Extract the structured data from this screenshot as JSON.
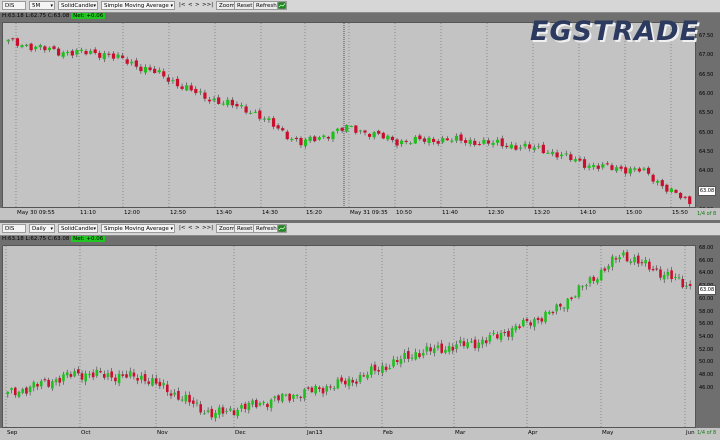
{
  "top": {
    "symbol": "DIS",
    "interval": "5M",
    "chart_style": "SolidCandle",
    "indicator": "Simple Moving Average",
    "nav": [
      "|<",
      "<",
      ">",
      ">>|"
    ],
    "zoom": "Zoom",
    "reset": "Reset",
    "refresh": "Refresh",
    "ohlc": "H:63.18  L:62.75  C:63.08",
    "net": "Net: +0.06",
    "price_tag": "63.08",
    "corner": "1/4 of 8",
    "logo": "EGSTRADE",
    "x_labels": [
      "May 30 09:55",
      "11:10",
      "12:00",
      "12:50",
      "13:40",
      "14:30",
      "15:20",
      "May 31 09:35",
      "10:50",
      "11:40",
      "12:30",
      "13:20",
      "14:10",
      "15:00",
      "15:50"
    ],
    "y_labels": [
      "67.50",
      "67.00",
      "66.50",
      "66.00",
      "65.50",
      "65.00",
      "64.50",
      "64.00",
      "63.50",
      "63.00"
    ]
  },
  "bottom": {
    "symbol": "DIS",
    "interval": "Daily",
    "chart_style": "SolidCandle",
    "indicator": "Simple Moving Average",
    "nav": [
      "|<",
      "<",
      ">",
      ">>|"
    ],
    "zoom": "Zoom",
    "reset": "Reset",
    "refresh": "Refresh",
    "ohlc": "H:63.18  L:62.75  C:63.08",
    "net": "Net: +0.06",
    "price_tag": "63.08",
    "corner": "1/4 of 8",
    "x_labels": [
      "Sep",
      "Oct",
      "Nov",
      "Dec",
      "Jan13",
      "Feb",
      "Mar",
      "Apr",
      "May",
      "Jun"
    ],
    "y_labels": [
      "68.00",
      "66.00",
      "64.00",
      "62.00",
      "60.00",
      "58.00",
      "56.00",
      "54.00",
      "52.00",
      "50.00",
      "48.00",
      "46.00"
    ]
  },
  "colors": {
    "up": "#1fbf1f",
    "down": "#c8102e",
    "plot_bg": "#c3c3c3",
    "net_bg": "#22c622"
  },
  "chart_data": [
    {
      "type": "candlestick",
      "ylim": [
        63.0,
        67.5
      ],
      "x": [
        "May 30 09:55",
        "11:10",
        "12:00",
        "12:50",
        "13:40",
        "14:30",
        "15:20",
        "May 31 09:35",
        "10:50",
        "11:40",
        "12:30",
        "13:20",
        "14:10",
        "15:00",
        "15:50"
      ],
      "close": [
        67.05,
        66.8,
        66.75,
        66.3,
        65.7,
        65.35,
        64.55,
        64.95,
        64.6,
        64.65,
        64.55,
        64.4,
        64.0,
        63.9,
        63.08
      ]
    },
    {
      "type": "candlestick",
      "ylim": [
        46.0,
        68.0
      ],
      "x": [
        "Sep",
        "Oct",
        "Nov",
        "Dec",
        "Jan13",
        "Feb",
        "Mar",
        "Apr",
        "May",
        "Jun"
      ],
      "close": [
        50.0,
        52.5,
        52.0,
        47.5,
        49.5,
        51.5,
        55.0,
        56.5,
        60.0,
        67.0,
        63.08
      ]
    }
  ]
}
